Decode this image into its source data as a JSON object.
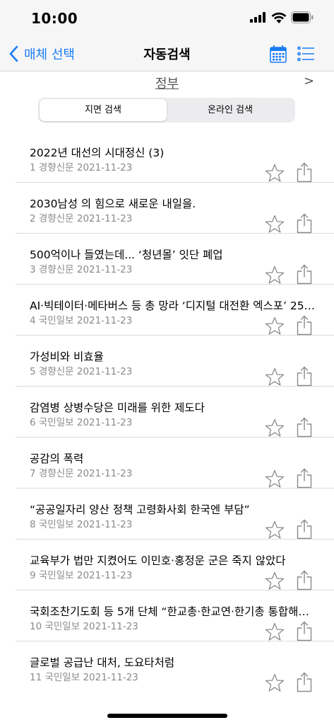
{
  "status": {
    "time": "10:00"
  },
  "nav": {
    "back_label": "매체 선택",
    "title": "자동검색"
  },
  "subheader": {
    "label": "정부",
    "next": ">"
  },
  "segment": {
    "items": [
      "지면 검색",
      "온라인 검색"
    ],
    "selected": 0
  },
  "articles": [
    {
      "title": "2022년 대선의 시대정신 (3)",
      "meta": "1 경향신문 2021-11-23"
    },
    {
      "title": "2030남성 의 힘으로 새로운 내일을.",
      "meta": "2 경향신문 2021-11-23"
    },
    {
      "title": "500억이나 들였는데... ‘청년몰’ 잇단 폐업",
      "meta": "3 경향신문 2021-11-23"
    },
    {
      "title": "AI·빅테이터·메타버스 등 총 망라 ‘디지털 대전환 엑스포’ 25…",
      "meta": "4 국민일보 2021-11-23"
    },
    {
      "title": "가성비와 비효율",
      "meta": "5 경향신문 2021-11-23"
    },
    {
      "title": "감염병 상병수당은 미래를 위한 제도다",
      "meta": "6 국민일보 2021-11-23"
    },
    {
      "title": "공감의 폭력",
      "meta": "7 경향신문 2021-11-23"
    },
    {
      "title": "“공공일자리 양산 정책 고령화사회 한국엔 부담”",
      "meta": "8 국민일보 2021-11-23"
    },
    {
      "title": "교육부가 법만 지켰어도 이민호·홍정운 군은 죽지 않았다",
      "meta": "9 국민일보 2021-11-23"
    },
    {
      "title": "국회조찬기도회 등 5개 단체 “한교총·한교연·한기총 통합해…",
      "meta": "10 국민일보 2021-11-23"
    },
    {
      "title": "글로벌 공급난 대처, 도요타처럼",
      "meta": "11 국민일보 2021-11-23"
    }
  ],
  "colors": {
    "accent": "#1a7cf5",
    "secondary_text": "#8a8a8e",
    "separator": "#dcdcde"
  }
}
